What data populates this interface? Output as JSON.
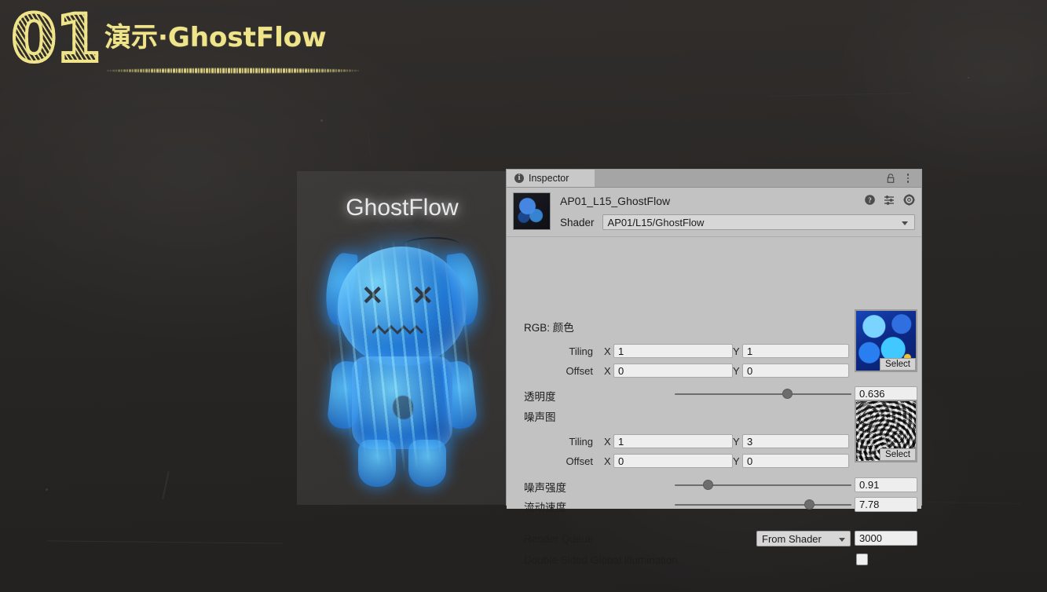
{
  "slide": {
    "number": "01",
    "title": "演示·GhostFlow",
    "accent_color": "#f0e48a",
    "background_color": "#2b2927"
  },
  "preview": {
    "title": "GhostFlow",
    "character_name": "ghost-character",
    "glow_color": "#3aa0ff"
  },
  "inspector": {
    "tab_label": "Inspector",
    "info_glyph": "i",
    "lock_icon": "lock-icon",
    "menu_icon": "kebab-menu-icon",
    "material_name": "AP01_L15_GhostFlow",
    "header_icons": [
      "help-icon",
      "preset-icon",
      "gear-icon"
    ],
    "shader_label": "Shader",
    "shader_value": "AP01/L15/GhostFlow",
    "color_section": {
      "label": "RGB: 颜色",
      "tiling_label": "Tiling",
      "offset_label": "Offset",
      "x_axis": "X",
      "y_axis": "Y",
      "tiling_x": "1",
      "tiling_y": "1",
      "offset_x": "0",
      "offset_y": "0",
      "texture_select_label": "Select",
      "texture_name": "color-texture-thumbnail"
    },
    "alpha": {
      "label": "透明度",
      "value": "0.636",
      "percent": 63.6
    },
    "noise_section": {
      "label": "噪声图",
      "tiling_label": "Tiling",
      "offset_label": "Offset",
      "x_axis": "X",
      "y_axis": "Y",
      "tiling_x": "1",
      "tiling_y": "3",
      "offset_x": "0",
      "offset_y": "0",
      "texture_select_label": "Select",
      "texture_name": "noise-texture-thumbnail"
    },
    "noise_strength": {
      "label": "噪声强度",
      "value": "0.91",
      "percent": 19
    },
    "flow_speed": {
      "label": "流动速度",
      "value": "7.78",
      "percent": 76
    },
    "render_queue": {
      "label": "Render Queue",
      "mode": "From Shader",
      "value": "3000"
    },
    "double_sided_gi": {
      "label": "Double Sided Global Illumination",
      "checked": false
    }
  }
}
